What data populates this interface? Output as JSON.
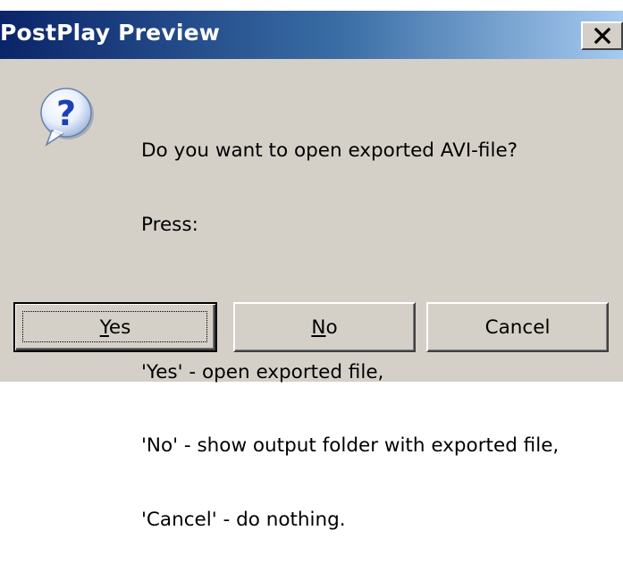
{
  "dialog": {
    "title": "PostPlay Preview",
    "message_lines": [
      "Do you want to open exported AVI-file?",
      "Press:",
      "",
      "'Yes' - open exported file,",
      "'No' - show output folder with exported file,",
      "'Cancel' - do nothing."
    ],
    "icon": "question-icon",
    "close_icon": "close-icon"
  },
  "buttons": {
    "yes": {
      "mnemonic": "Y",
      "rest": "es",
      "default": true
    },
    "no": {
      "mnemonic": "N",
      "rest": "o"
    },
    "cancel": {
      "label": "Cancel"
    }
  },
  "colors": {
    "titlebar_start": "#0a246a",
    "titlebar_end": "#a6caf0",
    "face": "#d4d0c8"
  }
}
